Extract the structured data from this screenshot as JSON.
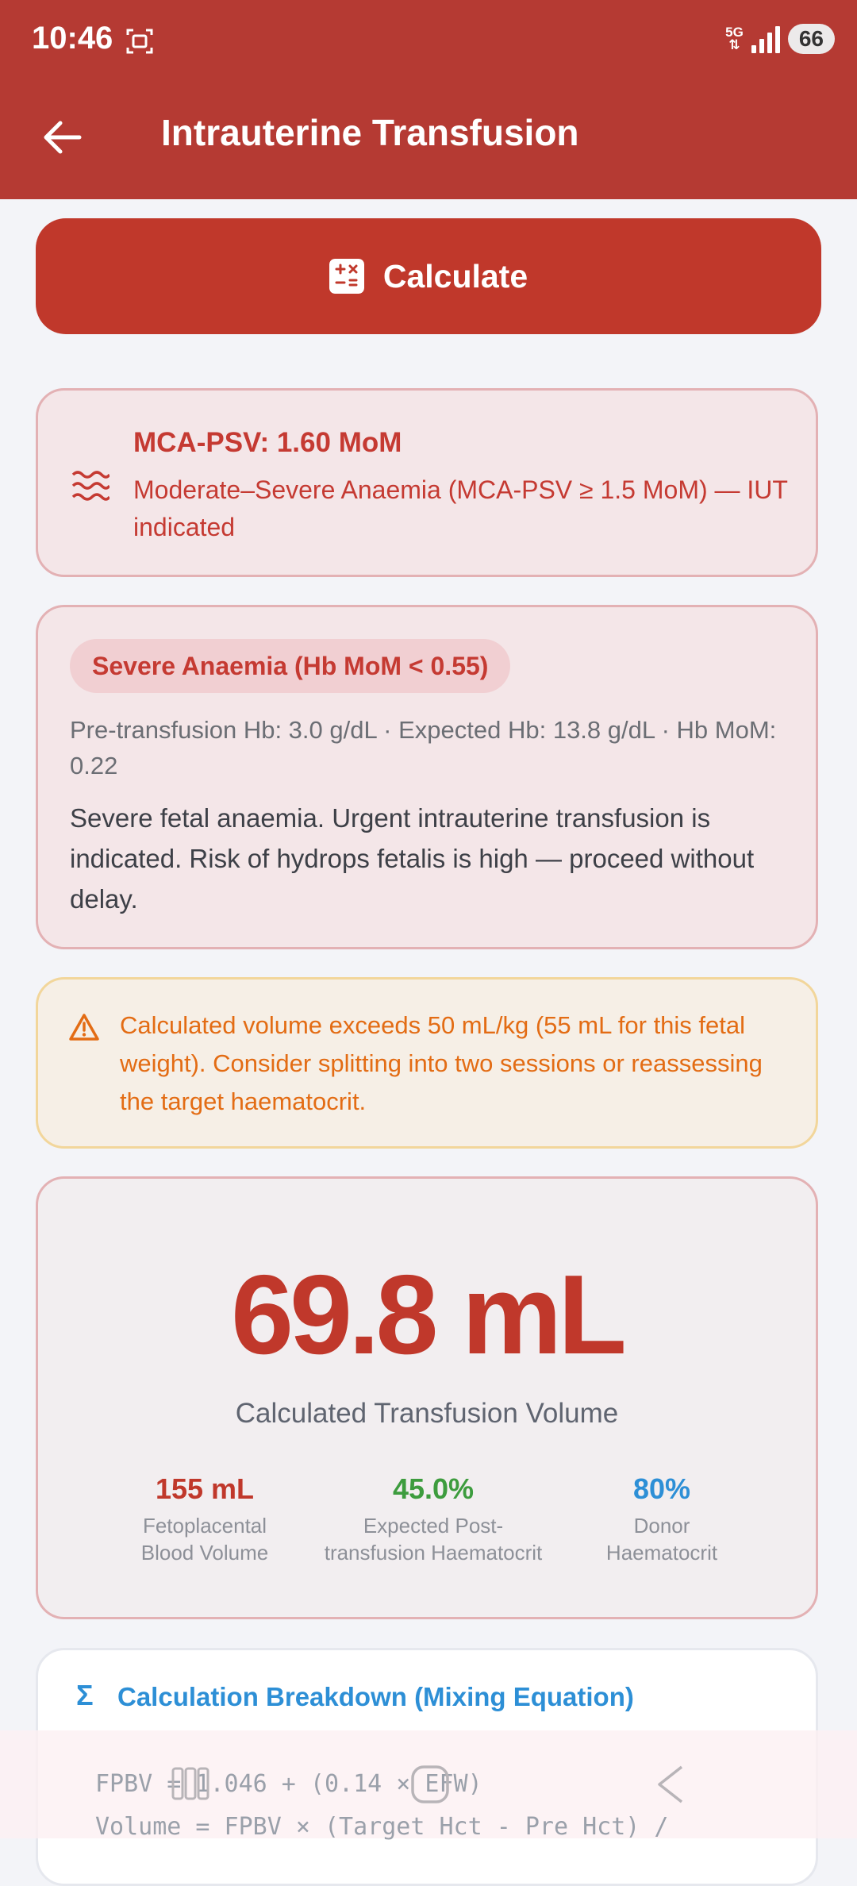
{
  "status_bar": {
    "time": "10:46",
    "network": "5G",
    "battery": "66"
  },
  "app_bar": {
    "title": "Intrauterine Transfusion"
  },
  "calculate_button": {
    "label": "Calculate"
  },
  "mca_card": {
    "title": "MCA-PSV: 1.60 MoM",
    "description": "Moderate–Severe Anaemia (MCA-PSV ≥ 1.5 MoM) — IUT indicated"
  },
  "severity_card": {
    "badge": "Severe Anaemia (Hb MoM < 0.55)",
    "values": "Pre-transfusion Hb: 3.0 g/dL  ·  Expected Hb: 13.8 g/dL  ·  Hb MoM: 0.22",
    "text": "Severe fetal anaemia. Urgent intrauterine transfusion is indicated. Risk of hydrops fetalis is high — proceed without delay."
  },
  "warning": {
    "text": "Calculated volume exceeds 50 mL/kg (55 mL for this fetal weight). Consider splitting into two sessions or reassessing the target haematocrit."
  },
  "result": {
    "value": "69.8 mL",
    "label": "Calculated Transfusion Volume",
    "stats": [
      {
        "value": "155 mL",
        "label": "Fetoplacental Blood Volume",
        "color": "#c0382b"
      },
      {
        "value": "45.0%",
        "label": "Expected Post-transfusion Haematocrit",
        "color": "#3d9c3e"
      },
      {
        "value": "80%",
        "label": "Donor Haematocrit",
        "color": "#2d8fd6"
      }
    ]
  },
  "breakdown": {
    "icon": "Σ",
    "title": "Calculation Breakdown (Mixing Equation)",
    "formula_line1": "FPBV = 1.046 + (0.14 × EFW)",
    "formula_line2": "Volume = FPBV × (Target Hct - Pre Hct) /"
  },
  "colors": {
    "primary": "#c0382b",
    "appbar": "#b53a33",
    "warning": "#e36c14",
    "accent_blue": "#2d8fd6",
    "accent_green": "#3d9c3e"
  },
  "icons": {
    "back": "arrow-left-icon",
    "calculate": "calculator-icon",
    "mca": "waves-icon",
    "warning": "warning-triangle-icon"
  }
}
